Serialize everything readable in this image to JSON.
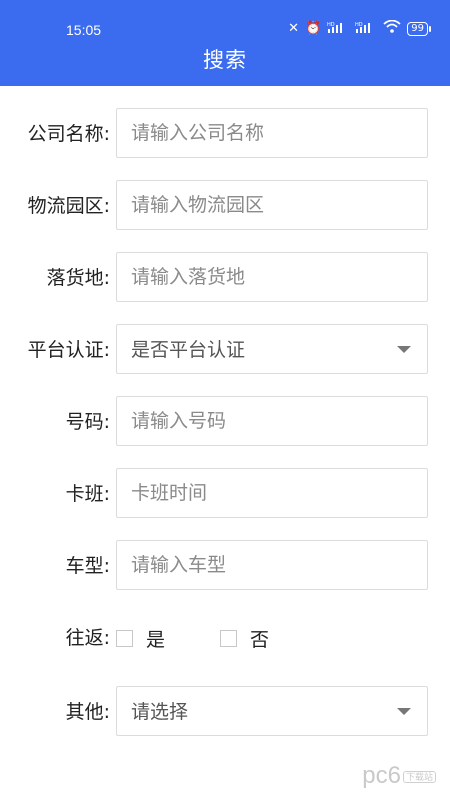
{
  "status_bar": {
    "time": "15:05",
    "battery": "99",
    "hd1": "HD",
    "hd2": "HD"
  },
  "header": {
    "title": "搜索"
  },
  "form": {
    "company": {
      "label": "公司名称:",
      "placeholder": "请输入公司名称"
    },
    "park": {
      "label": "物流园区:",
      "placeholder": "请输入物流园区"
    },
    "destination": {
      "label": "落货地:",
      "placeholder": "请输入落货地"
    },
    "platform_cert": {
      "label": "平台认证:",
      "value": "是否平台认证"
    },
    "number": {
      "label": "号码:",
      "placeholder": "请输入号码"
    },
    "shift": {
      "label": "卡班:",
      "placeholder": "卡班时间"
    },
    "vehicle": {
      "label": "车型:",
      "placeholder": "请输入车型"
    },
    "round_trip": {
      "label": "往返:",
      "options": [
        "是",
        "否"
      ]
    },
    "other": {
      "label": "其他:",
      "value": "请选择"
    }
  },
  "watermark": {
    "text": "pc6",
    "badge": "下载站"
  },
  "colors": {
    "accent": "#3b6cf0",
    "border": "#dcdcdc"
  }
}
